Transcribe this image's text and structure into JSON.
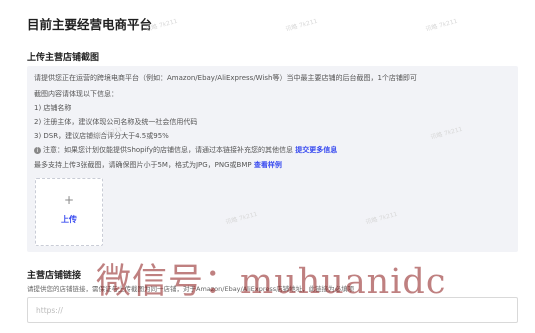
{
  "page_title": "目前主要经营电商平台",
  "store_screenshot": {
    "label": "上传主营店铺截图",
    "intro_line1": "请提供您正在运营的跨境电商平台（例如：Amazon/Ebay/AliExpress/Wish等）当中最主要店铺的后台截图，1个店铺即可",
    "intro_line2": "截图内容请体现以下信息：",
    "items": [
      "1) 店铺名称",
      "2) 注册主体，建议体现公司名称及统一社会信用代码",
      "3) DSR，建议店铺综合评分大于4.5或95%"
    ],
    "note_prefix": "注意：如果您计划仅能提供Shopify的店铺信息，请通过本链接补充您的其他信息",
    "note_link": "提交更多信息",
    "limit_text": "最多支持上传3张截图，请确保图片小于5M，格式为JPG，PNG或BMP",
    "limit_link": "查看样例",
    "upload_plus": "+",
    "upload_label": "上传"
  },
  "store_link": {
    "label": "主营店铺链接",
    "hint": "请提供您的店铺链接，需保证与上传截图为同一店铺，对于Amazon/Ebay/AliExpress店铺地址，此链接为必填项",
    "placeholder": "https://"
  },
  "watermark": "微信号：muhuanidc",
  "bg_watermark": "讯略 7k211"
}
